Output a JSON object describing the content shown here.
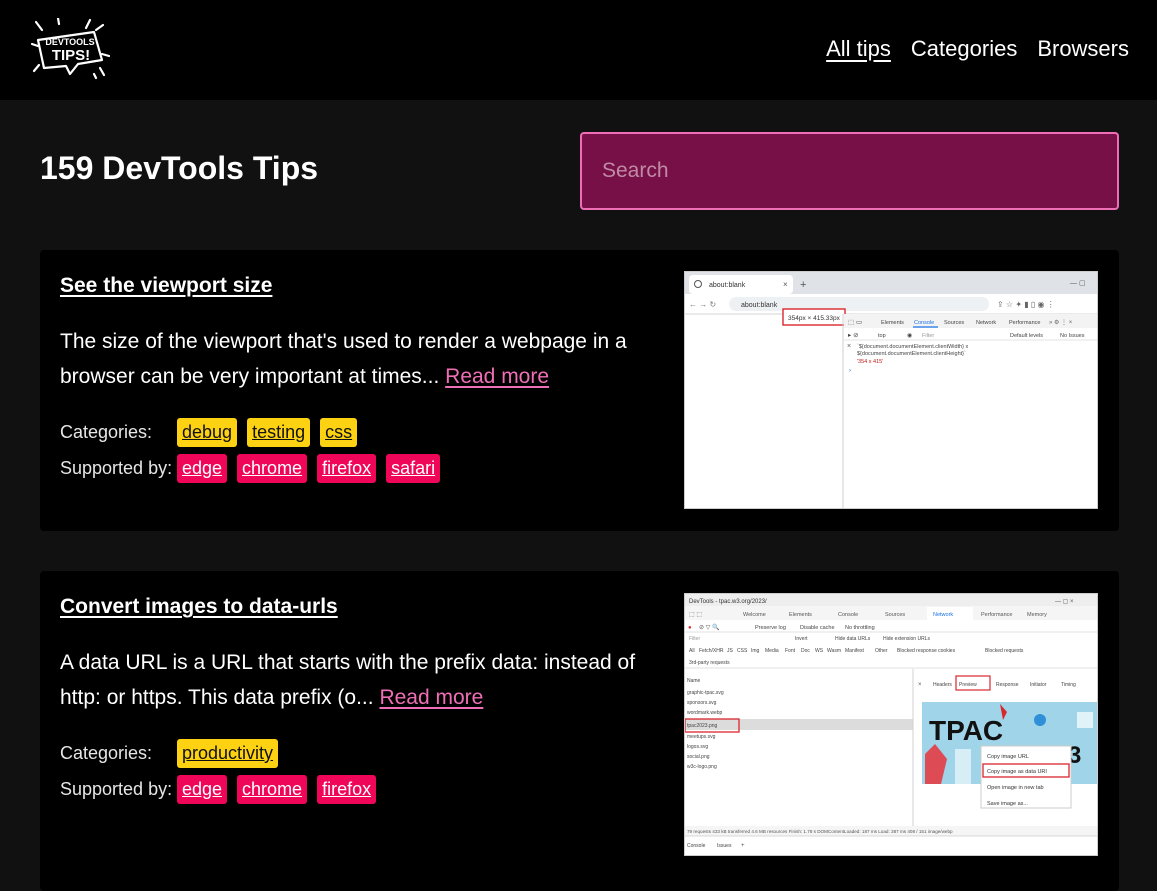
{
  "header": {
    "logo": {
      "line1": "DEVTOOLS",
      "line2": "TIPS!"
    },
    "nav": [
      {
        "label": "All tips",
        "active": true
      },
      {
        "label": "Categories",
        "active": false
      },
      {
        "label": "Browsers",
        "active": false
      }
    ]
  },
  "page": {
    "title": "159 DevTools Tips",
    "search_placeholder": "Search"
  },
  "labels": {
    "categories": "Categories:",
    "supported_by": "Supported by:"
  },
  "tips": [
    {
      "title": "See the viewport size",
      "description": "The size of the viewport that's used to render a webpage in a browser can be very important at times...",
      "read_more": "Read more",
      "categories": [
        "debug",
        "testing",
        "css"
      ],
      "browsers": [
        "edge",
        "chrome",
        "firefox",
        "safari"
      ],
      "screenshot": {
        "tab_title": "about:blank",
        "address": "about:blank",
        "size_readout": "354px × 415.33px",
        "devtools_tabs": [
          "Elements",
          "Console",
          "Sources",
          "Network",
          "Performance"
        ],
        "context": "top",
        "filter": "Filter",
        "levels": "Default levels",
        "issues": "No Issues",
        "code_line1": "`${document.documentElement.clientWidth} x",
        "code_line2": "${document.documentElement.clientHeight}`",
        "result": "'354 x 415'"
      }
    },
    {
      "title": "Convert images to data-urls",
      "description": "A data URL is a URL that starts with the prefix data: instead of http: or https. This data prefix (o...",
      "read_more": "Read more",
      "categories": [
        "productivity"
      ],
      "browsers": [
        "edge",
        "chrome",
        "firefox"
      ],
      "screenshot": {
        "window_title": "DevTools - tpac.w3.org/2023/",
        "devtools_tabs": [
          "Welcome",
          "Elements",
          "Console",
          "Sources",
          "Network",
          "Performance",
          "Memory"
        ],
        "options": [
          "Preserve log",
          "Disable cache",
          "No throttling"
        ],
        "filters": [
          "All",
          "Fetch/XHR",
          "JS",
          "CSS",
          "Img",
          "Media",
          "Font",
          "Doc",
          "WS",
          "Wasm",
          "Manifest",
          "Other"
        ],
        "extra_filters": [
          "Invert",
          "Hide data URLs",
          "Hide extension URLs",
          "Blocked response cookies",
          "Blocked requests"
        ],
        "third_party": "3rd-party requests",
        "detail_tabs": [
          "Headers",
          "Preview",
          "Response",
          "Initiator",
          "Timing"
        ],
        "files": [
          "Name",
          "graphic-tpac.svg",
          "sponsors.svg",
          "wordmark.webp",
          "tpac2023.png",
          "meetups.svg",
          "logos.svg",
          "social.png",
          "w3c-logo.png",
          "photo.png",
          "location.svg"
        ],
        "preview_text": "TPAC",
        "menu": [
          "Copy image URL",
          "Copy image as data URI",
          "Open image in new tab",
          "Save image as..."
        ],
        "status": "79 requests  433 kB transferred  4.6 MB resources  Finish: 1.78 s  DOMContentLoaded: 187 ms  Load: 387 ms  408 / 151  image/webp",
        "drawer_tabs": [
          "Console",
          "Issues"
        ]
      }
    }
  ]
}
